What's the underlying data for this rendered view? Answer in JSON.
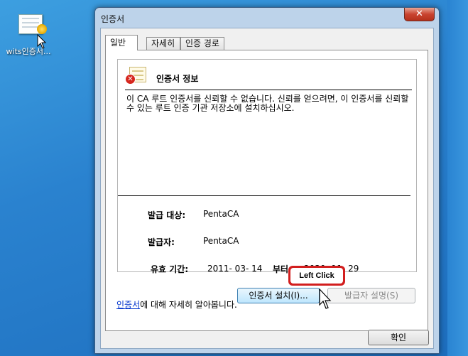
{
  "desktop": {
    "icon_label": "wits인증서..."
  },
  "window": {
    "title": "인증서",
    "close_glyph": "✕"
  },
  "tabs": [
    {
      "label": "일반"
    },
    {
      "label": "자세히"
    },
    {
      "label": "인증 경로"
    }
  ],
  "info": {
    "title": "인증서 정보",
    "warning": "이 CA 루트 인증서를 신뢰할 수 없습니다. 신뢰를 얻으려면, 이 인증서를 신뢰할 수 있는 루트 인증 기관 저장소에 설치하십시오.",
    "issued_to_label": "발급 대상:",
    "issued_to_value": "PentaCA",
    "issued_by_label": "발급자:",
    "issued_by_value": "PentaCA",
    "validity_label": "유효 기간:",
    "valid_from": "2011-  03-  14",
    "valid_word": "부터",
    "valid_to": "2030-  11-  29"
  },
  "buttons": {
    "install": "인증서 설치(I)...",
    "issuer_statement": "발급자 설명(S)",
    "ok": "확인"
  },
  "learn_more": {
    "link": "인증서",
    "rest": "에 대해 자세히 알아봅니다."
  },
  "annotation": {
    "callout": "Left Click"
  },
  "colors": {
    "desktop": "#2a82cf",
    "title_bar": "#bdd3ea",
    "close_button": "#c9432f",
    "link": "#0033cc",
    "callout_border": "#d21e1e"
  },
  "icons": [
    "certificate-icon",
    "error-icon",
    "close-icon",
    "mouse-cursor-icon"
  ]
}
